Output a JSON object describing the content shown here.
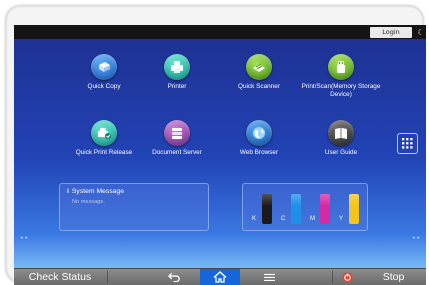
{
  "topbar": {
    "login_label": "Login",
    "moon_glyph": "☾"
  },
  "apps": [
    {
      "label": "Quick Copy",
      "icon": "copier-icon",
      "color": "blue"
    },
    {
      "label": "Printer",
      "icon": "printer-icon",
      "color": "teal"
    },
    {
      "label": "Quick Scanner",
      "icon": "scanner-icon",
      "color": "green"
    },
    {
      "label": "Print/Scan(Memory Storage Device)",
      "icon": "usb-storage-icon",
      "color": "green"
    },
    {
      "label": "Quick Print Release",
      "icon": "print-release-icon",
      "color": "teal"
    },
    {
      "label": "Document Server",
      "icon": "document-server-icon",
      "color": "purple"
    },
    {
      "label": "Web Browser",
      "icon": "globe-icon",
      "color": "blue"
    },
    {
      "label": "User Guide",
      "icon": "book-icon",
      "color": "dark"
    }
  ],
  "system_message": {
    "title": "System Message",
    "info_glyph": "i",
    "body": "No message."
  },
  "toner": [
    {
      "letter": "K",
      "color": "#1a1a1a",
      "level": 1.0
    },
    {
      "letter": "C",
      "color": "#1e90e8",
      "level": 1.0
    },
    {
      "letter": "M",
      "color": "#d42aa8",
      "level": 1.0
    },
    {
      "letter": "Y",
      "color": "#f3c41a",
      "level": 1.0
    }
  ],
  "bottombar": {
    "check_status_label": "Check Status",
    "stop_label": "Stop",
    "back_icon": "back-arrow-icon",
    "home_icon": "home-icon",
    "menu_icon": "menu-icon",
    "stop_icon": "stop-icon",
    "home_accent": "#1566d8"
  },
  "colors": {
    "screen_top": "#1e2f8f",
    "screen_bottom": "#77b9f5",
    "topbar": "#141414"
  }
}
